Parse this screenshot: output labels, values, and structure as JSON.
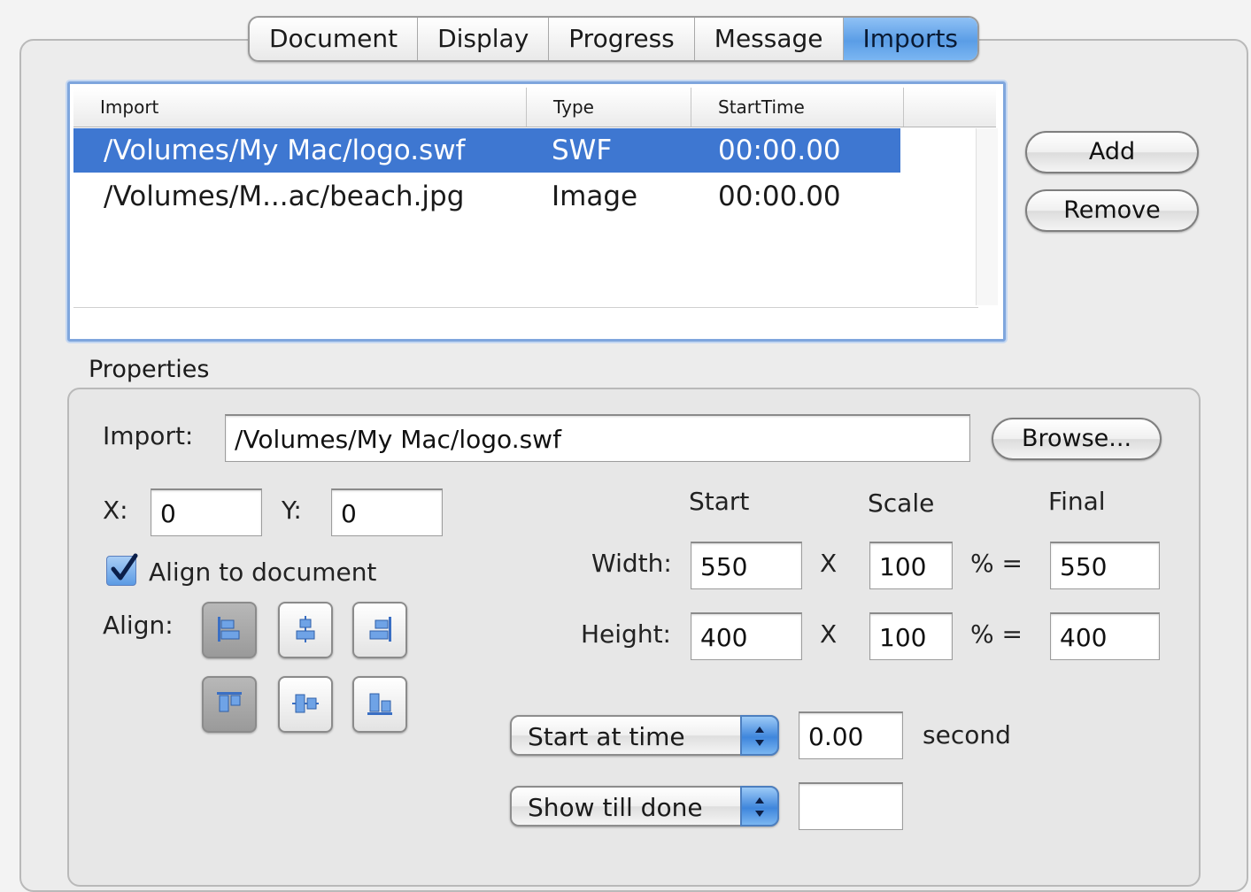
{
  "tabs": [
    {
      "label": "Document"
    },
    {
      "label": "Display"
    },
    {
      "label": "Progress"
    },
    {
      "label": "Message"
    },
    {
      "label": "Imports",
      "active": true
    }
  ],
  "imports_list": {
    "headers": {
      "import": "Import",
      "type": "Type",
      "start_time": "StartTime"
    },
    "rows": [
      {
        "import": "/Volumes/My Mac/logo.swf",
        "type": "SWF",
        "start_time": "00:00.00",
        "selected": true
      },
      {
        "import": "/Volumes/M...ac/beach.jpg",
        "type": "Image",
        "start_time": "00:00.00",
        "selected": false
      }
    ]
  },
  "buttons": {
    "add": "Add",
    "remove": "Remove",
    "browse": "Browse..."
  },
  "properties": {
    "section_label": "Properties",
    "import_label": "Import:",
    "import_value": "/Volumes/My Mac/logo.swf",
    "x_label": "X:",
    "x_value": "0",
    "y_label": "Y:",
    "y_value": "0",
    "align_to_document_label": "Align to document",
    "align_to_document_checked": true,
    "align_label": "Align:",
    "align_buttons": [
      "align-left-icon",
      "align-center-horizontal-icon",
      "align-right-icon",
      "align-top-icon",
      "align-middle-vertical-icon",
      "align-bottom-icon"
    ],
    "columns": {
      "start": "Start",
      "scale": "Scale",
      "final": "Final"
    },
    "width": {
      "label": "Width:",
      "start": "550",
      "x": "X",
      "scale": "100",
      "pct": "% =",
      "final": "550"
    },
    "height": {
      "label": "Height:",
      "start": "400",
      "x": "X",
      "scale": "100",
      "pct": "% =",
      "final": "400"
    },
    "start_mode": {
      "selected": "Start at time",
      "value": "0.00",
      "unit": "second"
    },
    "end_mode": {
      "selected": "Show till done",
      "value": ""
    }
  },
  "colors": {
    "selection": "#3e77d1",
    "active_tab": "#5a9de6"
  }
}
